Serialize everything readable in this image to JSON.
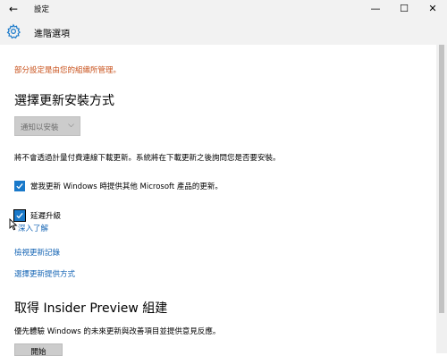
{
  "window": {
    "title": "設定",
    "back_icon": "back-arrow-icon",
    "minimize_glyph": "—",
    "maximize_glyph": "☐",
    "close_glyph": "✕"
  },
  "header": {
    "title": "進階選項",
    "icon": "gear-icon"
  },
  "main": {
    "policy_notice": "部分設定是由您的組織所管理。",
    "policy_color": "#c8501a",
    "install_section_title": "選擇更新安裝方式",
    "install_dropdown_value": "通知以安裝",
    "metered_description": "將不會透過計量付費連線下載更新。系統將在下載更新之後詢問您是否要安裝。",
    "checkbox_microsoft_label": "當我更新 Windows 時提供其他 Microsoft 產品的更新。",
    "checkbox_microsoft_checked": true,
    "checkbox_defer_label": "延遲升級",
    "checkbox_defer_checked": true,
    "learn_more_link": "深入了解",
    "view_history_link": "檢視更新記錄",
    "choose_delivery_link": "選擇更新提供方式",
    "insider_section_title": "取得 Insider Preview 組建",
    "insider_description": "優先體驗 Windows 的未來更新與改善項目並提供意見反應。",
    "start_button_label": "開始",
    "accent_color": "#1979ca",
    "link_color": "#1464b4"
  }
}
